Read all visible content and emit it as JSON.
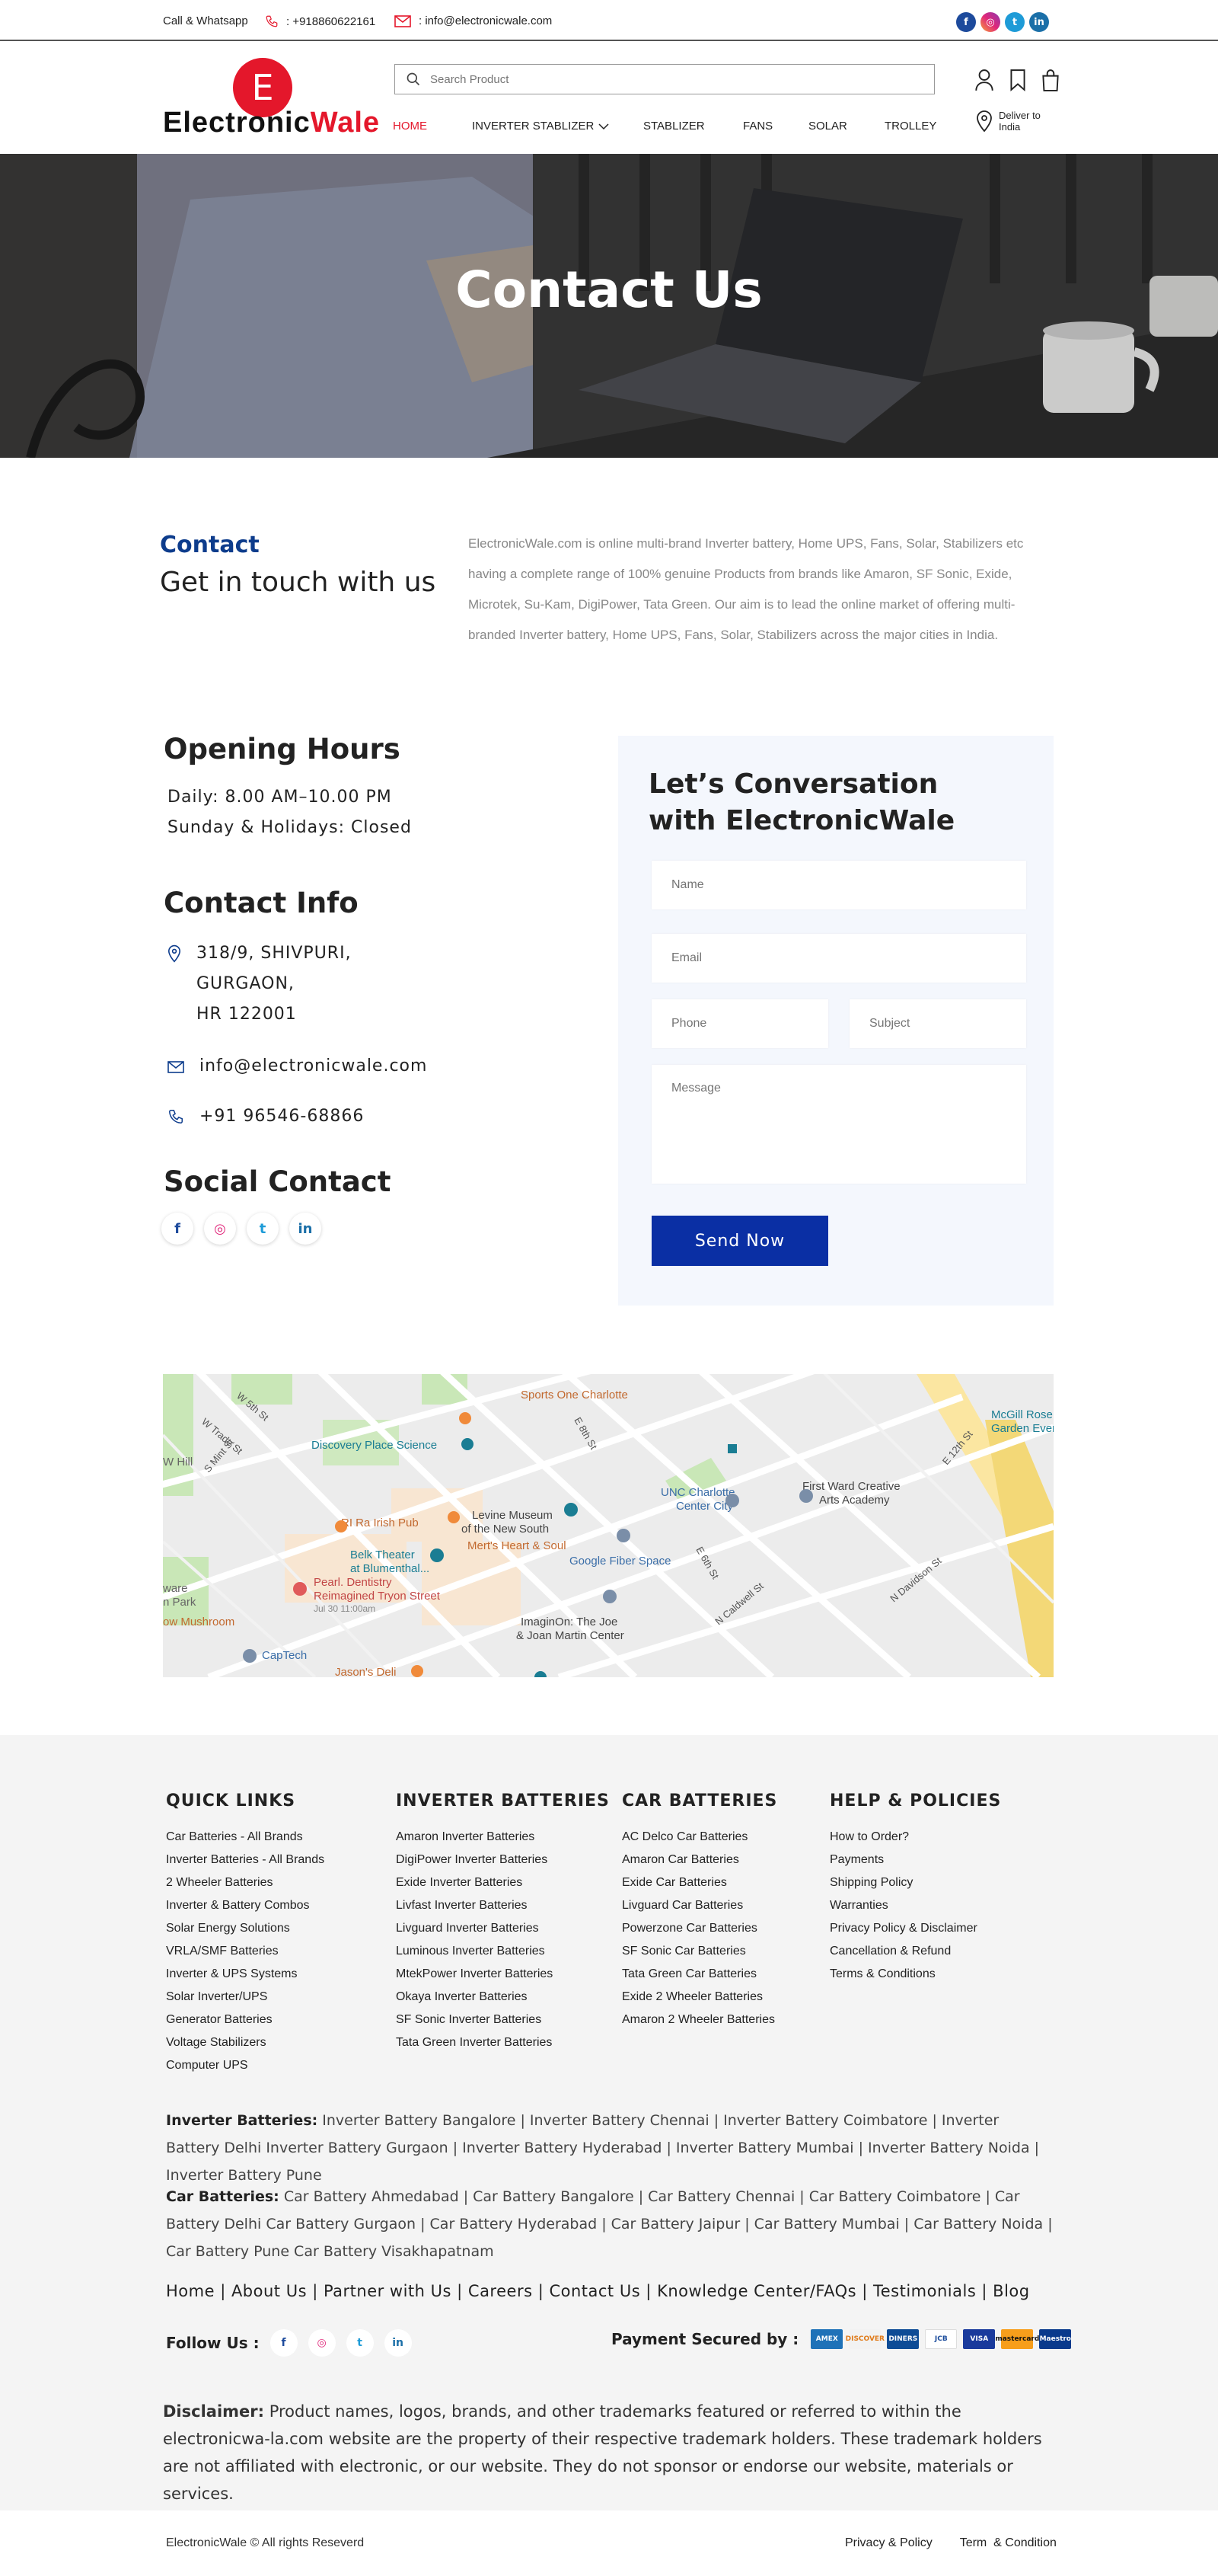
{
  "topbar": {
    "call_label": "Call & Whatsapp",
    "phone": ": +918860622161",
    "email": ": info@electronicwale.com",
    "social": [
      "facebook-icon",
      "instagram-icon",
      "twitter-icon",
      "linkedin-icon"
    ]
  },
  "brand": {
    "logo_letter": "E",
    "name_part1": "Electronic",
    "name_part2": "Wale",
    "accent": "#e4172b",
    "primary": "#0a2fa4"
  },
  "search": {
    "placeholder": "Search Product"
  },
  "nav": [
    {
      "label": "HOME",
      "active": true
    },
    {
      "label": "INVERTER STABLIZER"
    },
    {
      "label": "STABLIZER"
    },
    {
      "label": "FANS"
    },
    {
      "label": "SOLAR"
    },
    {
      "label": "TROLLEY"
    }
  ],
  "deliver": {
    "line1": "Deliver to",
    "line2": "India"
  },
  "hero": {
    "title": "Contact Us"
  },
  "intro": {
    "kicker": "Contact",
    "heading": "Get in touch with us",
    "about": "ElectronicWale.com is online multi-brand Inverter battery, Home UPS, Fans, Solar, Stabilizers etc having a complete range of 100% genuine Products from brands like Amaron, SF Sonic, Exide, Microtek, Su-Kam, DigiPower, Tata Green. Our aim is to lead the online market of offering multi-branded Inverter battery, Home UPS, Fans, Solar, Stabilizers across the major cities in India."
  },
  "hours": {
    "heading": "Opening Hours",
    "line1": "Daily: 8.00 AM–10.00 PM",
    "line2": "Sunday & Holidays: Closed"
  },
  "contact_info": {
    "heading": "Contact Info",
    "address1": "318/9, SHIVPURI,",
    "address2": "GURGAON,",
    "address3": "HR 122001",
    "email": "info@electronicwale.com",
    "phone": "+91 96546-68866"
  },
  "social_contact": {
    "heading": "Social Contact"
  },
  "form": {
    "heading1": "Let’s Conversation",
    "heading2": "with ElectronicWale",
    "name_placeholder": "Name",
    "email_placeholder": "Email",
    "phone_placeholder": "Phone",
    "subject_placeholder": "Subject",
    "message_placeholder": "Message",
    "submit": "Send Now"
  },
  "map": {
    "labels": [
      "Sports One Charlotte",
      "Discovery Place Science",
      "UNC Charlotte Center City",
      "First Ward Creative Arts Academy",
      "McGill Rose Garden Events",
      "Levine Museum of the New South",
      "RI Ra Irish Pub",
      "Mert's Heart & Soul",
      "Belk Theater at Blumenthal...",
      "Google Fiber Space",
      "Pearl. Dentistry Reimagined Tryon Street",
      "Jul 30 11:00am",
      "ImaginOn: The Joe & Joan Martin Center",
      "CapTech",
      "Jason's Deli",
      "W 5th St",
      "W Trade St",
      "S Mint St",
      "N Davidson St",
      "E 12th St",
      "E 8th St",
      "E 6th St",
      "N Caldwell St",
      "W Hill",
      "ow Mushroom",
      "ware",
      "n Park"
    ]
  },
  "footer": {
    "quick_links": {
      "heading": "QUICK LINKS",
      "items": [
        "Car Batteries - All Brands",
        "Inverter Batteries - All Brands",
        "2 Wheeler Batteries",
        "Inverter & Battery Combos",
        "Solar Energy Solutions",
        "VRLA/SMF Batteries",
        "Inverter & UPS Systems",
        "Solar Inverter/UPS",
        "Generator Batteries",
        "Voltage Stabilizers",
        "Computer UPS"
      ]
    },
    "inverter_batteries": {
      "heading": "INVERTER BATTERIES",
      "items": [
        "Amaron Inverter Batteries",
        "DigiPower Inverter Batteries",
        "Exide Inverter Batteries",
        "Livfast Inverter Batteries",
        "Livguard Inverter Batteries",
        "Luminous Inverter Batteries",
        "MtekPower Inverter Batteries",
        "Okaya Inverter Batteries",
        "SF Sonic Inverter Batteries",
        "Tata Green Inverter Batteries"
      ]
    },
    "car_batteries": {
      "heading": "CAR BATTERIES",
      "items": [
        "AC Delco Car Batteries",
        "Amaron Car Batteries",
        "Exide Car Batteries",
        "Livguard Car Batteries",
        "Powerzone Car Batteries",
        "SF Sonic Car Batteries",
        "Tata Green Car Batteries",
        "Exide 2 Wheeler Batteries",
        "Amaron 2 Wheeler Batteries"
      ]
    },
    "help": {
      "heading": "HELP & POLICIES",
      "items": [
        "How to Order?",
        "Payments",
        "Shipping Policy",
        "Warranties",
        "Privacy Policy & Disclaimer",
        "Cancellation & Refund",
        "Terms & Conditions"
      ]
    },
    "inverter_cities_label": "Inverter Batteries:",
    "inverter_cities": " Inverter Battery Bangalore | Inverter Battery Chennai | Inverter Battery Coimbatore | Inverter Battery Delhi Inverter Battery Gurgaon | Inverter Battery Hyderabad | Inverter Battery Mumbai | Inverter Battery Noida | Inverter Battery Pune",
    "car_cities_label": "Car Batteries:",
    "car_cities": " Car Battery Ahmedabad | Car Battery Bangalore | Car Battery Chennai | Car Battery Coimbatore | Car Battery Delhi Car Battery Gurgaon | Car Battery Hyderabad | Car Battery Jaipur | Car Battery Mumbai | Car Battery Noida | Car Battery Pune Car Battery Visakhapatnam",
    "page_links": "Home | About Us | Partner with Us | Careers | Contact Us | Knowledge Center/FAQs | Testimonials | Blog",
    "follow_label": "Follow Us :",
    "payment_label": "Payment Secured by :",
    "payment_cards": [
      "AMEX",
      "DISCOVER",
      "DINERS",
      "JCB",
      "VISA",
      "mastercard",
      "Maestro"
    ],
    "disclaimer_label": "Disclaimer:",
    "disclaimer": " Product names, logos, brands, and other trademarks featured or referred to within the electronicwa-la.com website are the property of their respective trademark holders. These trademark holders are not affiliated with electronic, or our website. They do not sponsor or endorse our website, materials or services.",
    "copyright": "ElectronicWale © All rights Reseverd",
    "privacy": "Privacy & Policy",
    "terms": "Term  & Condition"
  }
}
